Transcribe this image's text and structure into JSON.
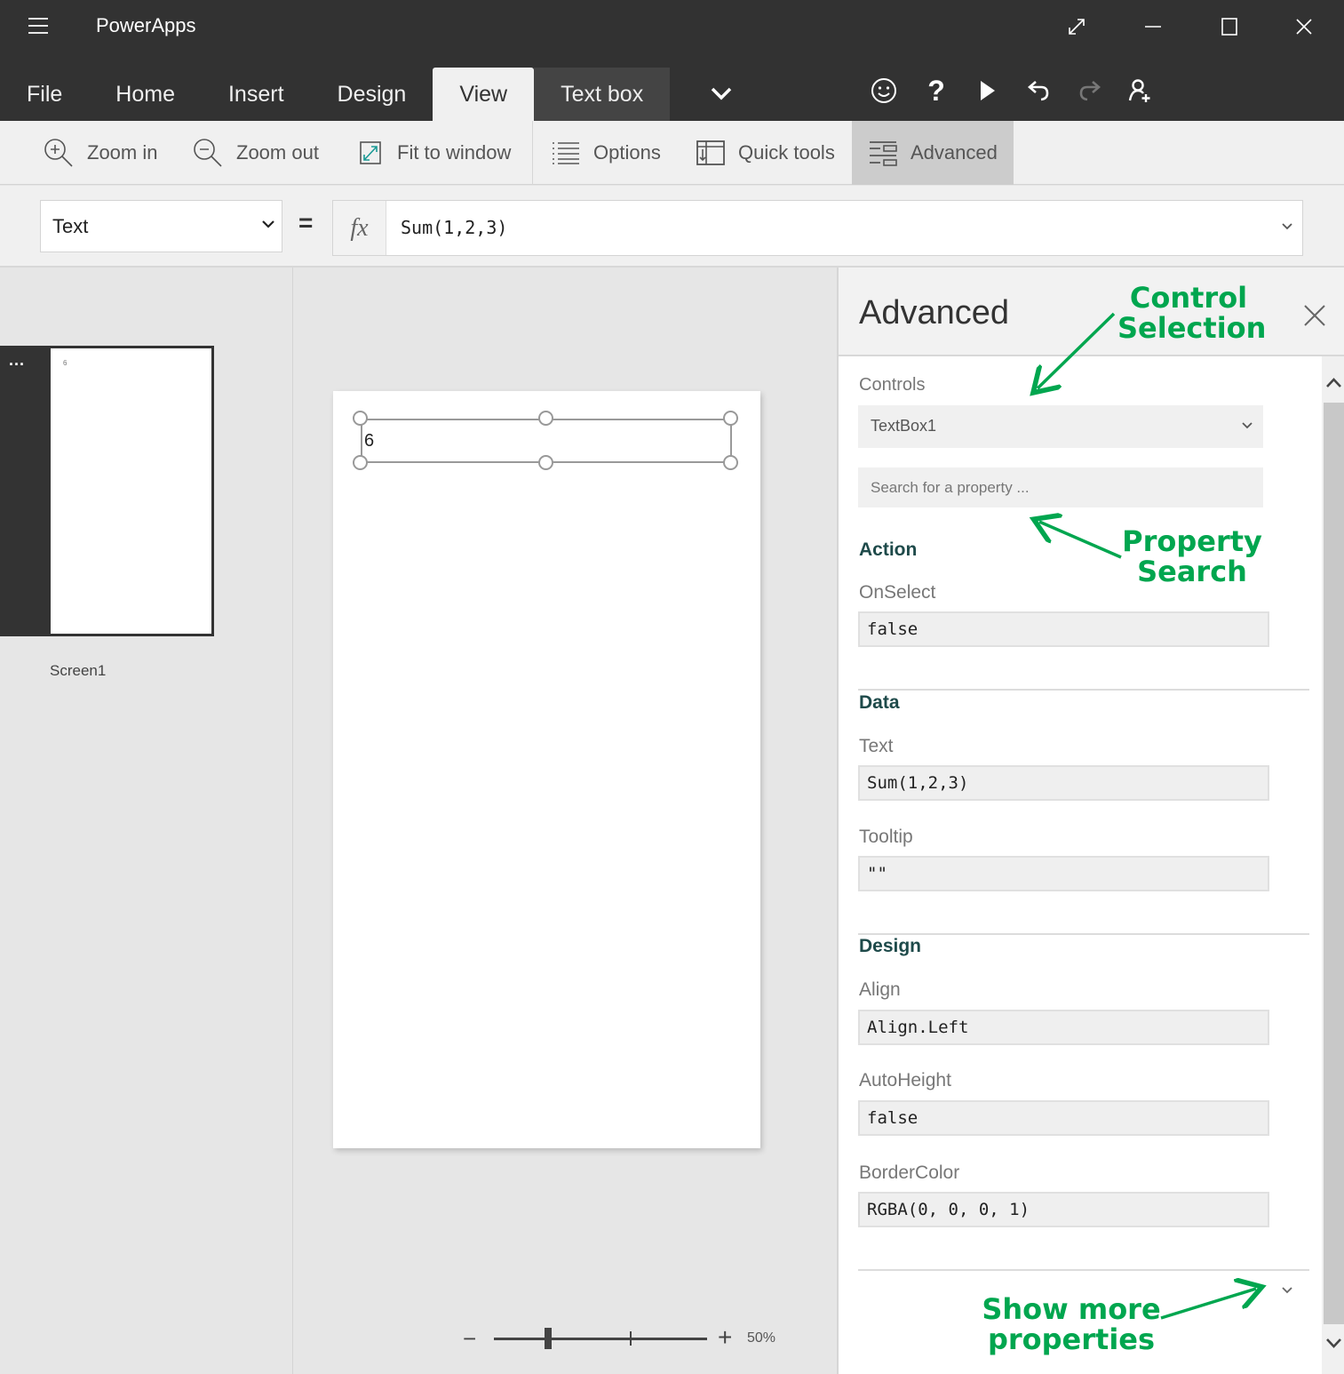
{
  "app": {
    "title": "PowerApps"
  },
  "window_controls": [
    "resize-icon",
    "minimize-icon",
    "maximize-icon",
    "close-icon"
  ],
  "tabs": [
    {
      "label": "File",
      "active": false
    },
    {
      "label": "Home",
      "active": false
    },
    {
      "label": "Insert",
      "active": false
    },
    {
      "label": "Design",
      "active": false
    },
    {
      "label": "View",
      "active": true
    },
    {
      "label": "Text box",
      "context": true
    }
  ],
  "toolbar_icons": [
    "feedback-smiley-icon",
    "help-icon",
    "play-icon",
    "undo-icon",
    "redo-icon",
    "share-user-icon"
  ],
  "ribbon": {
    "zoom_in": "Zoom in",
    "zoom_out": "Zoom out",
    "fit_to_window": "Fit to window",
    "options": "Options",
    "quick_tools": "Quick tools",
    "advanced": "Advanced"
  },
  "formula_bar": {
    "property": "Text",
    "equals": "=",
    "fx": "fx",
    "formula": "Sum(1,2,3)"
  },
  "screens_panel": {
    "more": "...",
    "thumb_text": "6",
    "screen_name": "Screen1"
  },
  "canvas": {
    "textbox_value": "6",
    "zoom": {
      "minus": "−",
      "plus": "+",
      "value": "50%",
      "level_percent": 50
    }
  },
  "advanced_panel": {
    "title": "Advanced",
    "controls_label": "Controls",
    "selected_control": "TextBox1",
    "search_placeholder": "Search for a property ...",
    "sections": [
      {
        "title": "Action",
        "properties": [
          {
            "name": "OnSelect",
            "value": "false"
          }
        ]
      },
      {
        "title": "Data",
        "properties": [
          {
            "name": "Text",
            "value": "Sum(1,2,3)"
          },
          {
            "name": "Tooltip",
            "value": "\"\""
          }
        ]
      },
      {
        "title": "Design",
        "properties": [
          {
            "name": "Align",
            "value": "Align.Left"
          },
          {
            "name": "AutoHeight",
            "value": "false"
          },
          {
            "name": "BorderColor",
            "value": "RGBA(0, 0, 0, 1)"
          }
        ]
      }
    ]
  },
  "annotations": {
    "color": "#00a64f",
    "control_selection": [
      "Control",
      "Selection"
    ],
    "property_search": [
      "Property",
      "Search"
    ],
    "show_more": [
      "Show more",
      "properties"
    ]
  }
}
